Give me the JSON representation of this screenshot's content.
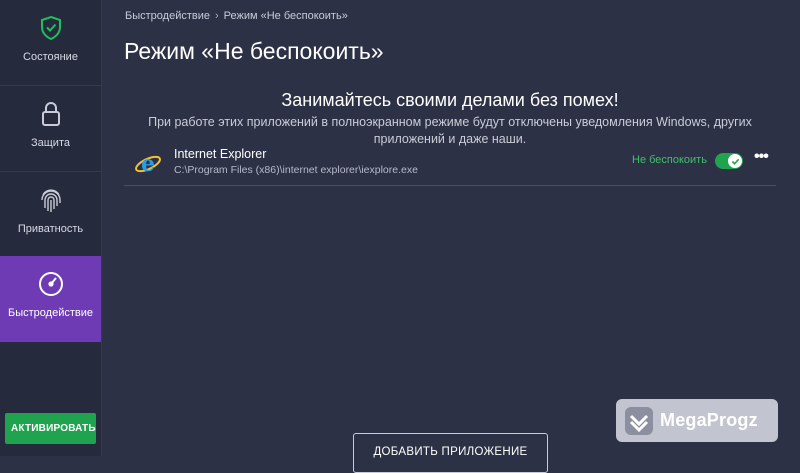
{
  "sidebar": {
    "items": [
      {
        "label": "Состояние",
        "icon": "shield-check-icon"
      },
      {
        "label": "Защита",
        "icon": "lock-icon"
      },
      {
        "label": "Приватность",
        "icon": "fingerprint-icon"
      },
      {
        "label": "Быстродействие",
        "icon": "speedometer-icon",
        "active": true
      }
    ],
    "activate_label": "АКТИВИРОВАТЬ"
  },
  "breadcrumb": {
    "parent": "Быстродействие",
    "separator": "›",
    "current": "Режим «Не беспокоить»"
  },
  "page_title": "Режим «Не беспокоить»",
  "headline": "Занимайтесь своими делами без помех!",
  "description": "При работе этих приложений в полноэкранном режиме будут отключены уведомления Windows, других приложений и даже наши.",
  "apps": [
    {
      "name": "Internet Explorer",
      "path": "C:\\Program Files (x86)\\internet explorer\\iexplore.exe",
      "status_label": "Не беспокоить",
      "enabled": true,
      "icon": "internet-explorer-icon"
    }
  ],
  "more_label": "•••",
  "add_app_label": "ДОБАВИТЬ ПРИЛОЖЕНИЕ",
  "watermark": "MegaProgz",
  "colors": {
    "background": "#2d3145",
    "sidebar": "#252a3c",
    "active_nav": "#6f3bb5",
    "accent_green": "#1fa34f",
    "status_green": "#3fc06a"
  }
}
